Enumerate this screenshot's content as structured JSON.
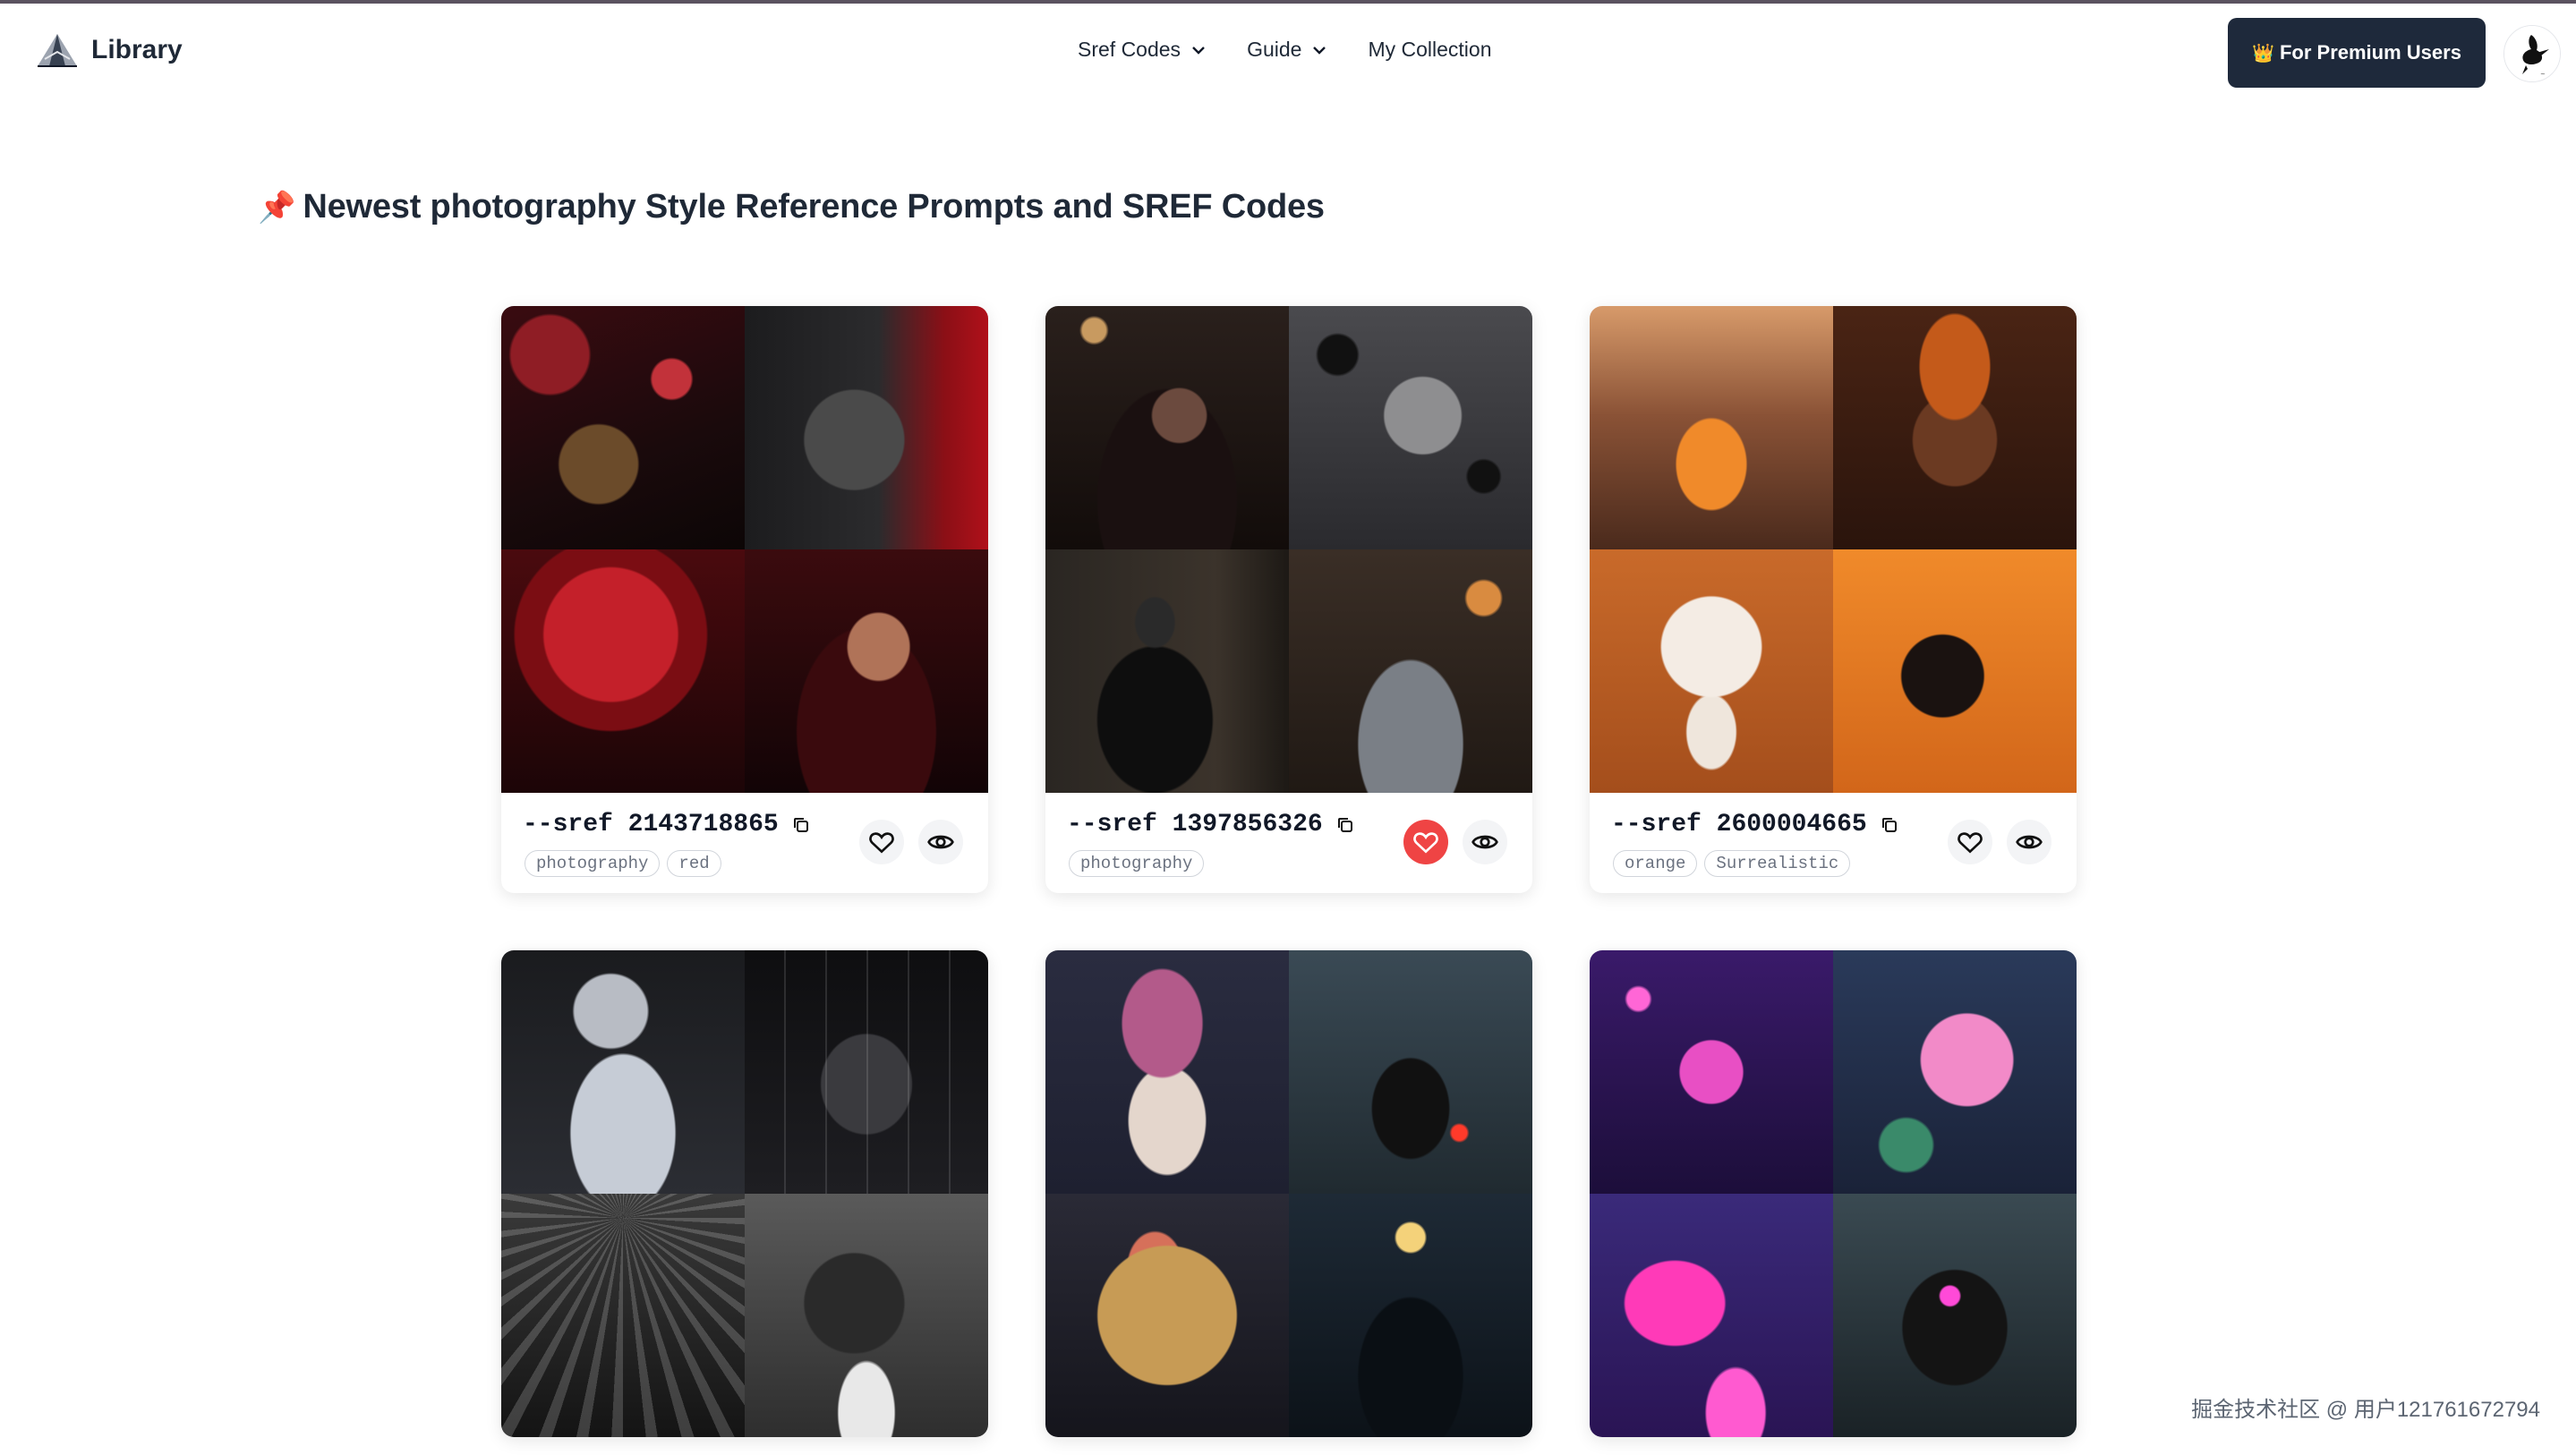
{
  "nav": {
    "logo_text": "Library",
    "items": [
      {
        "label": "Sref Codes",
        "has_dropdown": true
      },
      {
        "label": "Guide",
        "has_dropdown": true
      },
      {
        "label": "My Collection",
        "has_dropdown": false
      }
    ],
    "premium_button": {
      "icon": "👑",
      "label": "For Premium Users"
    }
  },
  "page": {
    "heading_icon": "📌",
    "heading": "Newest photography Style Reference Prompts and SREF Codes"
  },
  "cards": [
    {
      "sref_prefix": "--sref",
      "code": "2143718865",
      "tags": [
        "photography",
        "red"
      ],
      "liked": false
    },
    {
      "sref_prefix": "--sref",
      "code": "1397856326",
      "tags": [
        "photography"
      ],
      "liked": true
    },
    {
      "sref_prefix": "--sref",
      "code": "2600004665",
      "tags": [
        "orange",
        "Surrealistic"
      ],
      "liked": false
    },
    {
      "sref_prefix": "",
      "code": "",
      "tags": [],
      "liked": false
    },
    {
      "sref_prefix": "",
      "code": "",
      "tags": [],
      "liked": false
    },
    {
      "sref_prefix": "",
      "code": "",
      "tags": [],
      "liked": false
    }
  ],
  "icons": {
    "copy": "copy-icon",
    "like": "heart-icon",
    "view": "eye-icon",
    "dropdown": "chevron-down-icon"
  },
  "colors": {
    "premium_bg": "#1e293b",
    "liked": "#ef4444",
    "text": "#1f2937"
  },
  "watermark": "掘金技术社区 @ 用户121761672794"
}
